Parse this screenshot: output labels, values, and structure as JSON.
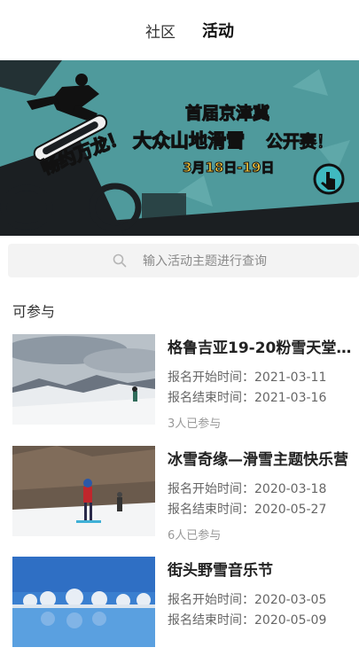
{
  "header": {
    "tabs": [
      {
        "label": "社区",
        "active": false
      },
      {
        "label": "活动",
        "active": true
      }
    ]
  },
  "banner": {
    "accent_text": "畅约万龙！",
    "line1": "首届京津冀",
    "line2_highlight": "大众山地滑雪",
    "line2_rest": "公开赛！",
    "dates": "3月18日-19日",
    "colors": {
      "background": "#4f9a9c",
      "highlight": "#f3c53a",
      "dark": "#1b1f22"
    }
  },
  "search": {
    "placeholder": "输入活动主题进行查询",
    "icon": "search-icon"
  },
  "section": {
    "title": "可参与"
  },
  "activities": [
    {
      "title": "格鲁吉亚19-20粉雪天堂全...",
      "start_label": "报名开始时间：",
      "start_date": "2021-03-11",
      "end_label": "报名结束时间：",
      "end_date": "2021-03-16",
      "participants": "3人已参与"
    },
    {
      "title": "冰雪奇缘—滑雪主题快乐营",
      "start_label": "报名开始时间：",
      "start_date": "2020-03-18",
      "end_label": "报名结束时间：",
      "end_date": "2020-05-27",
      "participants": "6人已参与"
    },
    {
      "title": "街头野雪音乐节",
      "start_label": "报名开始时间：",
      "start_date": "2020-03-05",
      "end_label": "报名结束时间：",
      "end_date": "2020-05-09",
      "participants": ""
    }
  ]
}
